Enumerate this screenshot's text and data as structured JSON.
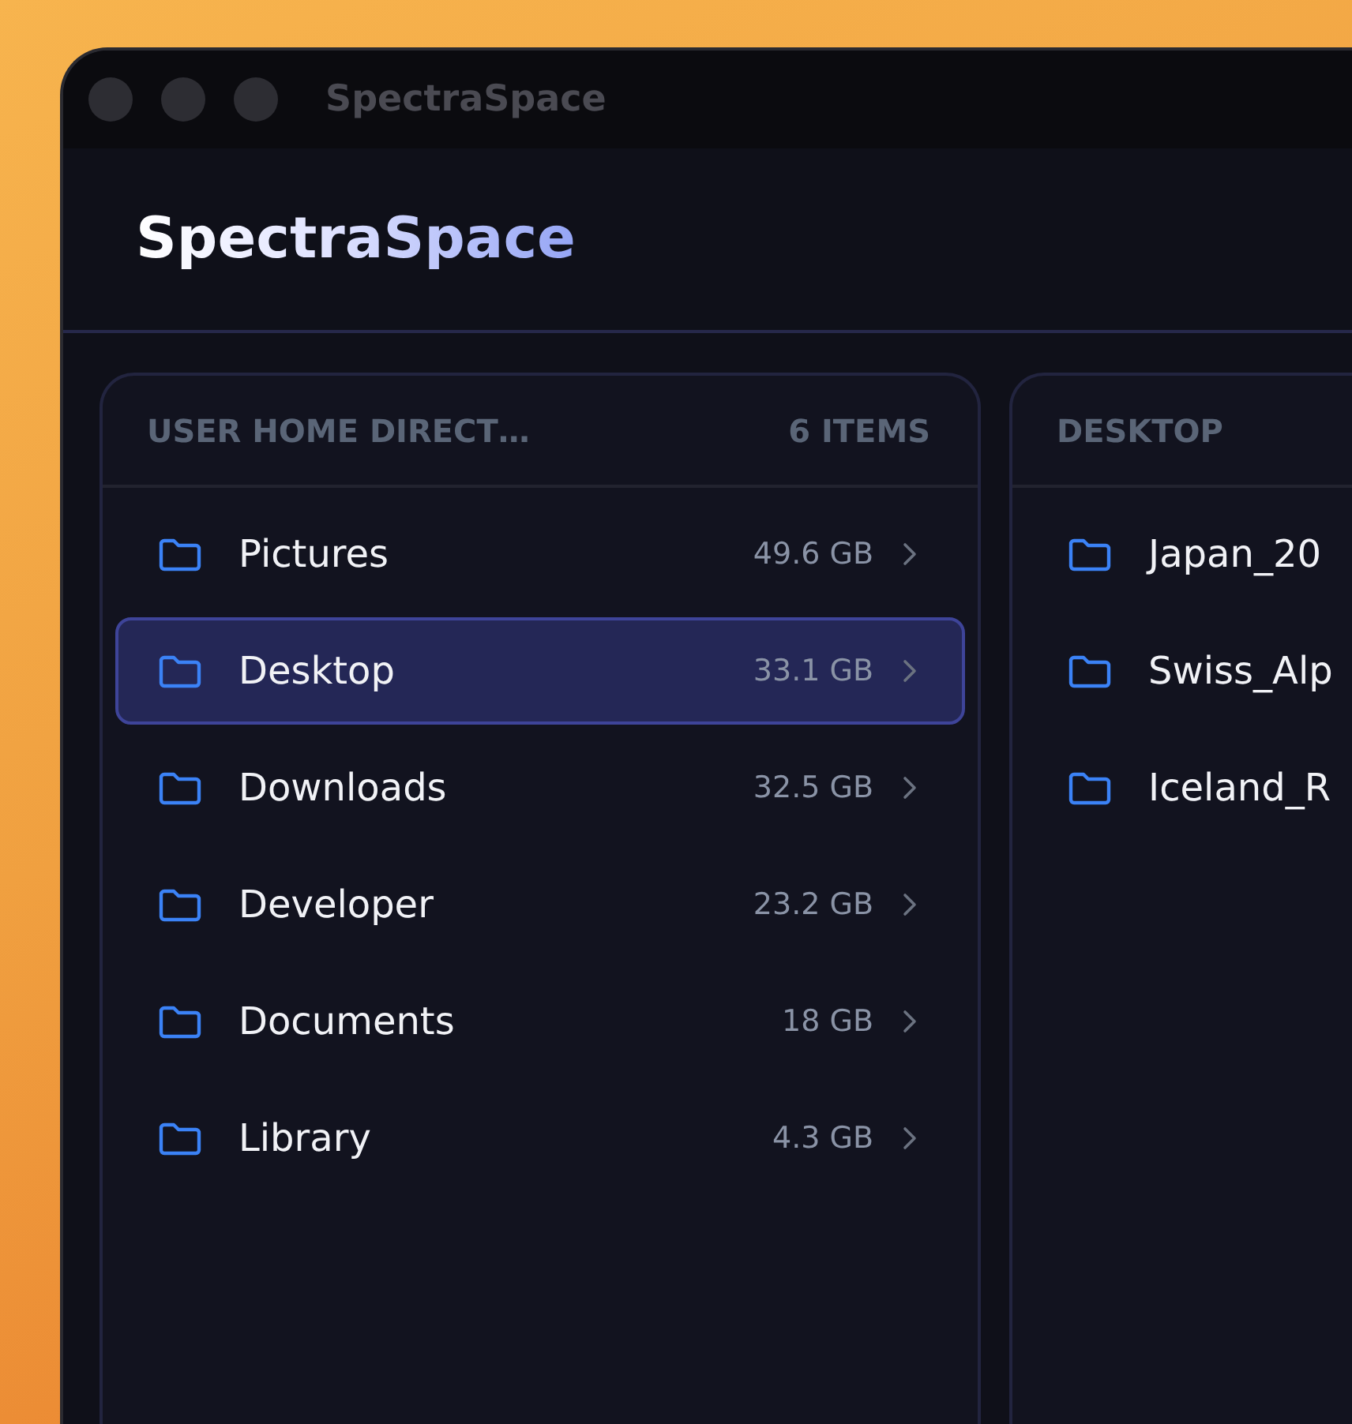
{
  "window": {
    "title": "SpectraSpace"
  },
  "app": {
    "title": "SpectraSpace"
  },
  "columns": [
    {
      "header": "USER HOME DIRECT…",
      "count": "6 ITEMS",
      "items": [
        {
          "name": "Pictures",
          "size": "49.6 GB",
          "selected": false
        },
        {
          "name": "Desktop",
          "size": "33.1 GB",
          "selected": true
        },
        {
          "name": "Downloads",
          "size": "32.5 GB",
          "selected": false
        },
        {
          "name": "Developer",
          "size": "23.2 GB",
          "selected": false
        },
        {
          "name": "Documents",
          "size": "18 GB",
          "selected": false
        },
        {
          "name": "Library",
          "size": "4.3 GB",
          "selected": false
        }
      ]
    },
    {
      "header": "DESKTOP",
      "items": [
        {
          "name": "Japan_20",
          "selected": false
        },
        {
          "name": "Swiss_Alp",
          "selected": false
        },
        {
          "name": "Iceland_R",
          "selected": false
        }
      ]
    }
  ]
}
